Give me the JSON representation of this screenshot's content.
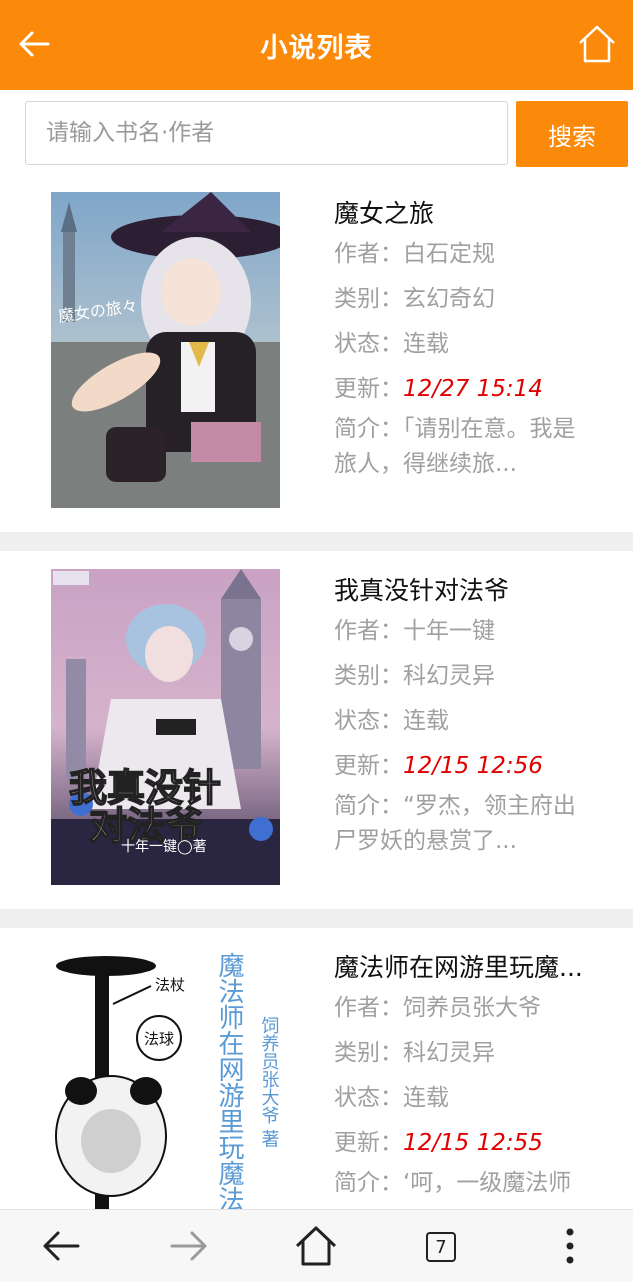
{
  "header": {
    "title": "小说列表"
  },
  "search": {
    "placeholder": "请输入书名·作者",
    "button": "搜索"
  },
  "labels": {
    "author": "作者：",
    "category": "类别：",
    "status": "状态：",
    "updated": "更新：",
    "intro": "简介："
  },
  "books": [
    {
      "title": "魔女之旅",
      "author": "白石定规",
      "category": "玄幻奇幻",
      "status": "连载",
      "updated": "12/27 15:14",
      "intro": "「请别在意。我是旅人，得继续旅...",
      "cover_text": "魔女の旅々"
    },
    {
      "title": "我真没针对法爷",
      "author": "十年一键",
      "category": "科幻灵异",
      "status": "连载",
      "updated": "12/15 12:56",
      "intro": "“罗杰，领主府出尸罗妖的悬赏了...",
      "cover_text": [
        "我真没针",
        "对法爷",
        "十年一键◯著"
      ]
    },
    {
      "title": "魔法师在网游里玩魔...",
      "author": "饲养员张大爷",
      "category": "科幻灵异",
      "status": "连载",
      "updated": "12/15 12:55",
      "intro": "‘呵，一级魔法师",
      "cover_text": [
        "法杖",
        "法球",
        "魔法师在网游里玩魔法",
        "饲养员张大爷 著"
      ]
    }
  ],
  "bottom_nav": {
    "tabs_count": "7"
  },
  "colors": {
    "accent": "#fb8a0a",
    "update_time": "#e00000",
    "muted": "#a0a0a0"
  }
}
